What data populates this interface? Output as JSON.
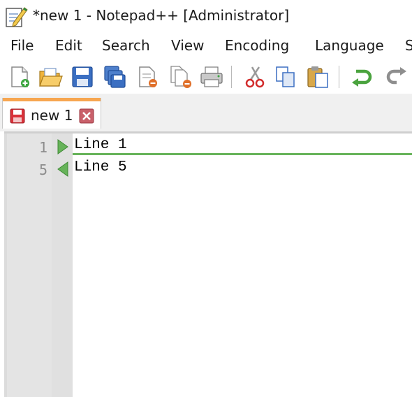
{
  "window": {
    "title": "*new 1 - Notepad++ [Administrator]"
  },
  "menu": {
    "items": [
      "File",
      "Edit",
      "Search",
      "View",
      "Encoding",
      "Language",
      "S"
    ]
  },
  "toolbar": {
    "buttons": [
      "new-file",
      "open-file",
      "save",
      "save-all",
      "close",
      "close-all",
      "print",
      "cut",
      "copy",
      "paste",
      "undo",
      "redo"
    ]
  },
  "tabs": [
    {
      "label": "new 1",
      "modified": true
    }
  ],
  "editor": {
    "lines": [
      {
        "number": "1",
        "text": "Line 1"
      },
      {
        "number": "5",
        "text": "Line 5"
      }
    ],
    "colors": {
      "hidden_lines_marker": "#67b35a",
      "tab_accent": "#f7a650"
    }
  }
}
